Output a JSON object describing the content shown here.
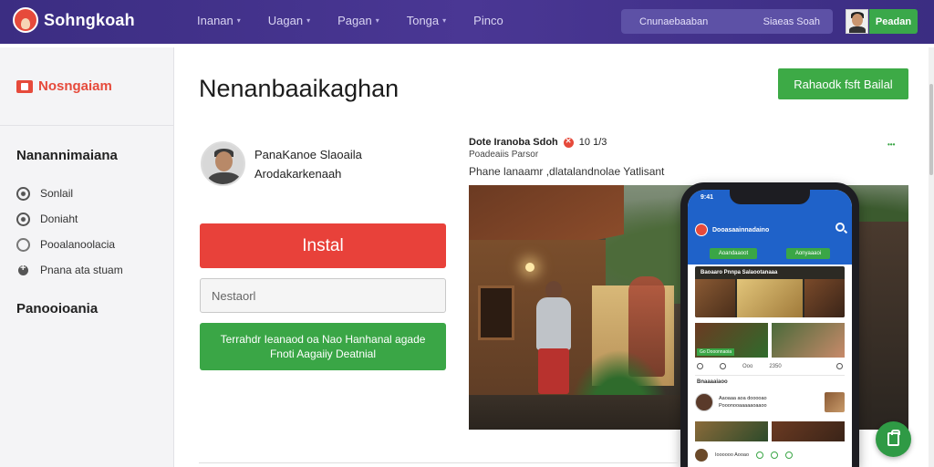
{
  "header": {
    "brand": "Sohngkoah",
    "nav": [
      {
        "label": "Inanan",
        "dropdown": true
      },
      {
        "label": "Uagan",
        "dropdown": true
      },
      {
        "label": "Pagan",
        "dropdown": true
      },
      {
        "label": "Tonga",
        "dropdown": true
      },
      {
        "label": "Pinco",
        "dropdown": false
      }
    ],
    "search_placeholder": "Cnunaebaaban",
    "search_action": "Siaeas Soah",
    "user_button": "Peadan"
  },
  "sidebar": {
    "brand": "Nosngaiam",
    "section1_title": "Nanannimaiana",
    "items": [
      {
        "label": "Sonlail",
        "icon": "settings-dot-icon"
      },
      {
        "label": "Doniaht",
        "icon": "clock-icon"
      },
      {
        "label": "Pooalanoolacia",
        "icon": "circle-icon"
      },
      {
        "label": "Pnana ata stuam",
        "icon": "add-user-icon"
      }
    ],
    "section2_title": "Panooioania"
  },
  "main": {
    "title": "Nenanbaaikaghan",
    "header_button": "Rahaodk fsft Bailal",
    "profile": {
      "line1": "PanaKanoe Slaoaila",
      "line2": "Arodakarkenaah"
    },
    "install_button": "Instal",
    "input_placeholder": "Nestaorl",
    "green_button_line1": "Terrahdr Ieanaod oa Nao Hanhanal agade",
    "green_button_line2": "Fnoti Aagaiiy Deatnial"
  },
  "post": {
    "author": "Dote Iranoba Sdoh",
    "timestamp": "10 1/3",
    "subtitle": "Poadeaiis Parsor",
    "caption": "Phane lanaamr ,dlatalandnolae Yatlisant",
    "menu": "•••"
  },
  "phone": {
    "time": "9:41",
    "app_name": "Dooasaainnadaino",
    "tabs": [
      "Aoandaaoot",
      "Aonyaaaoi"
    ],
    "banner_title": "Baoaaro Pnnpa Salaootanaaa",
    "thumb_label": "Go Dooonnaoia",
    "meta": [
      "Ooo",
      "2350"
    ],
    "comments_title": "Bnaaaaiaoo",
    "comment_name": "Aaoaaa aoa dooooao",
    "comment_text": "Pooonooaaaaaoaaoo",
    "bottom_text": "Ioooooo Aooao"
  },
  "colors": {
    "topbar": "#3b2d82",
    "accent_red": "#e8413a",
    "accent_green": "#3aa646",
    "phone_blue": "#1f62c9"
  }
}
